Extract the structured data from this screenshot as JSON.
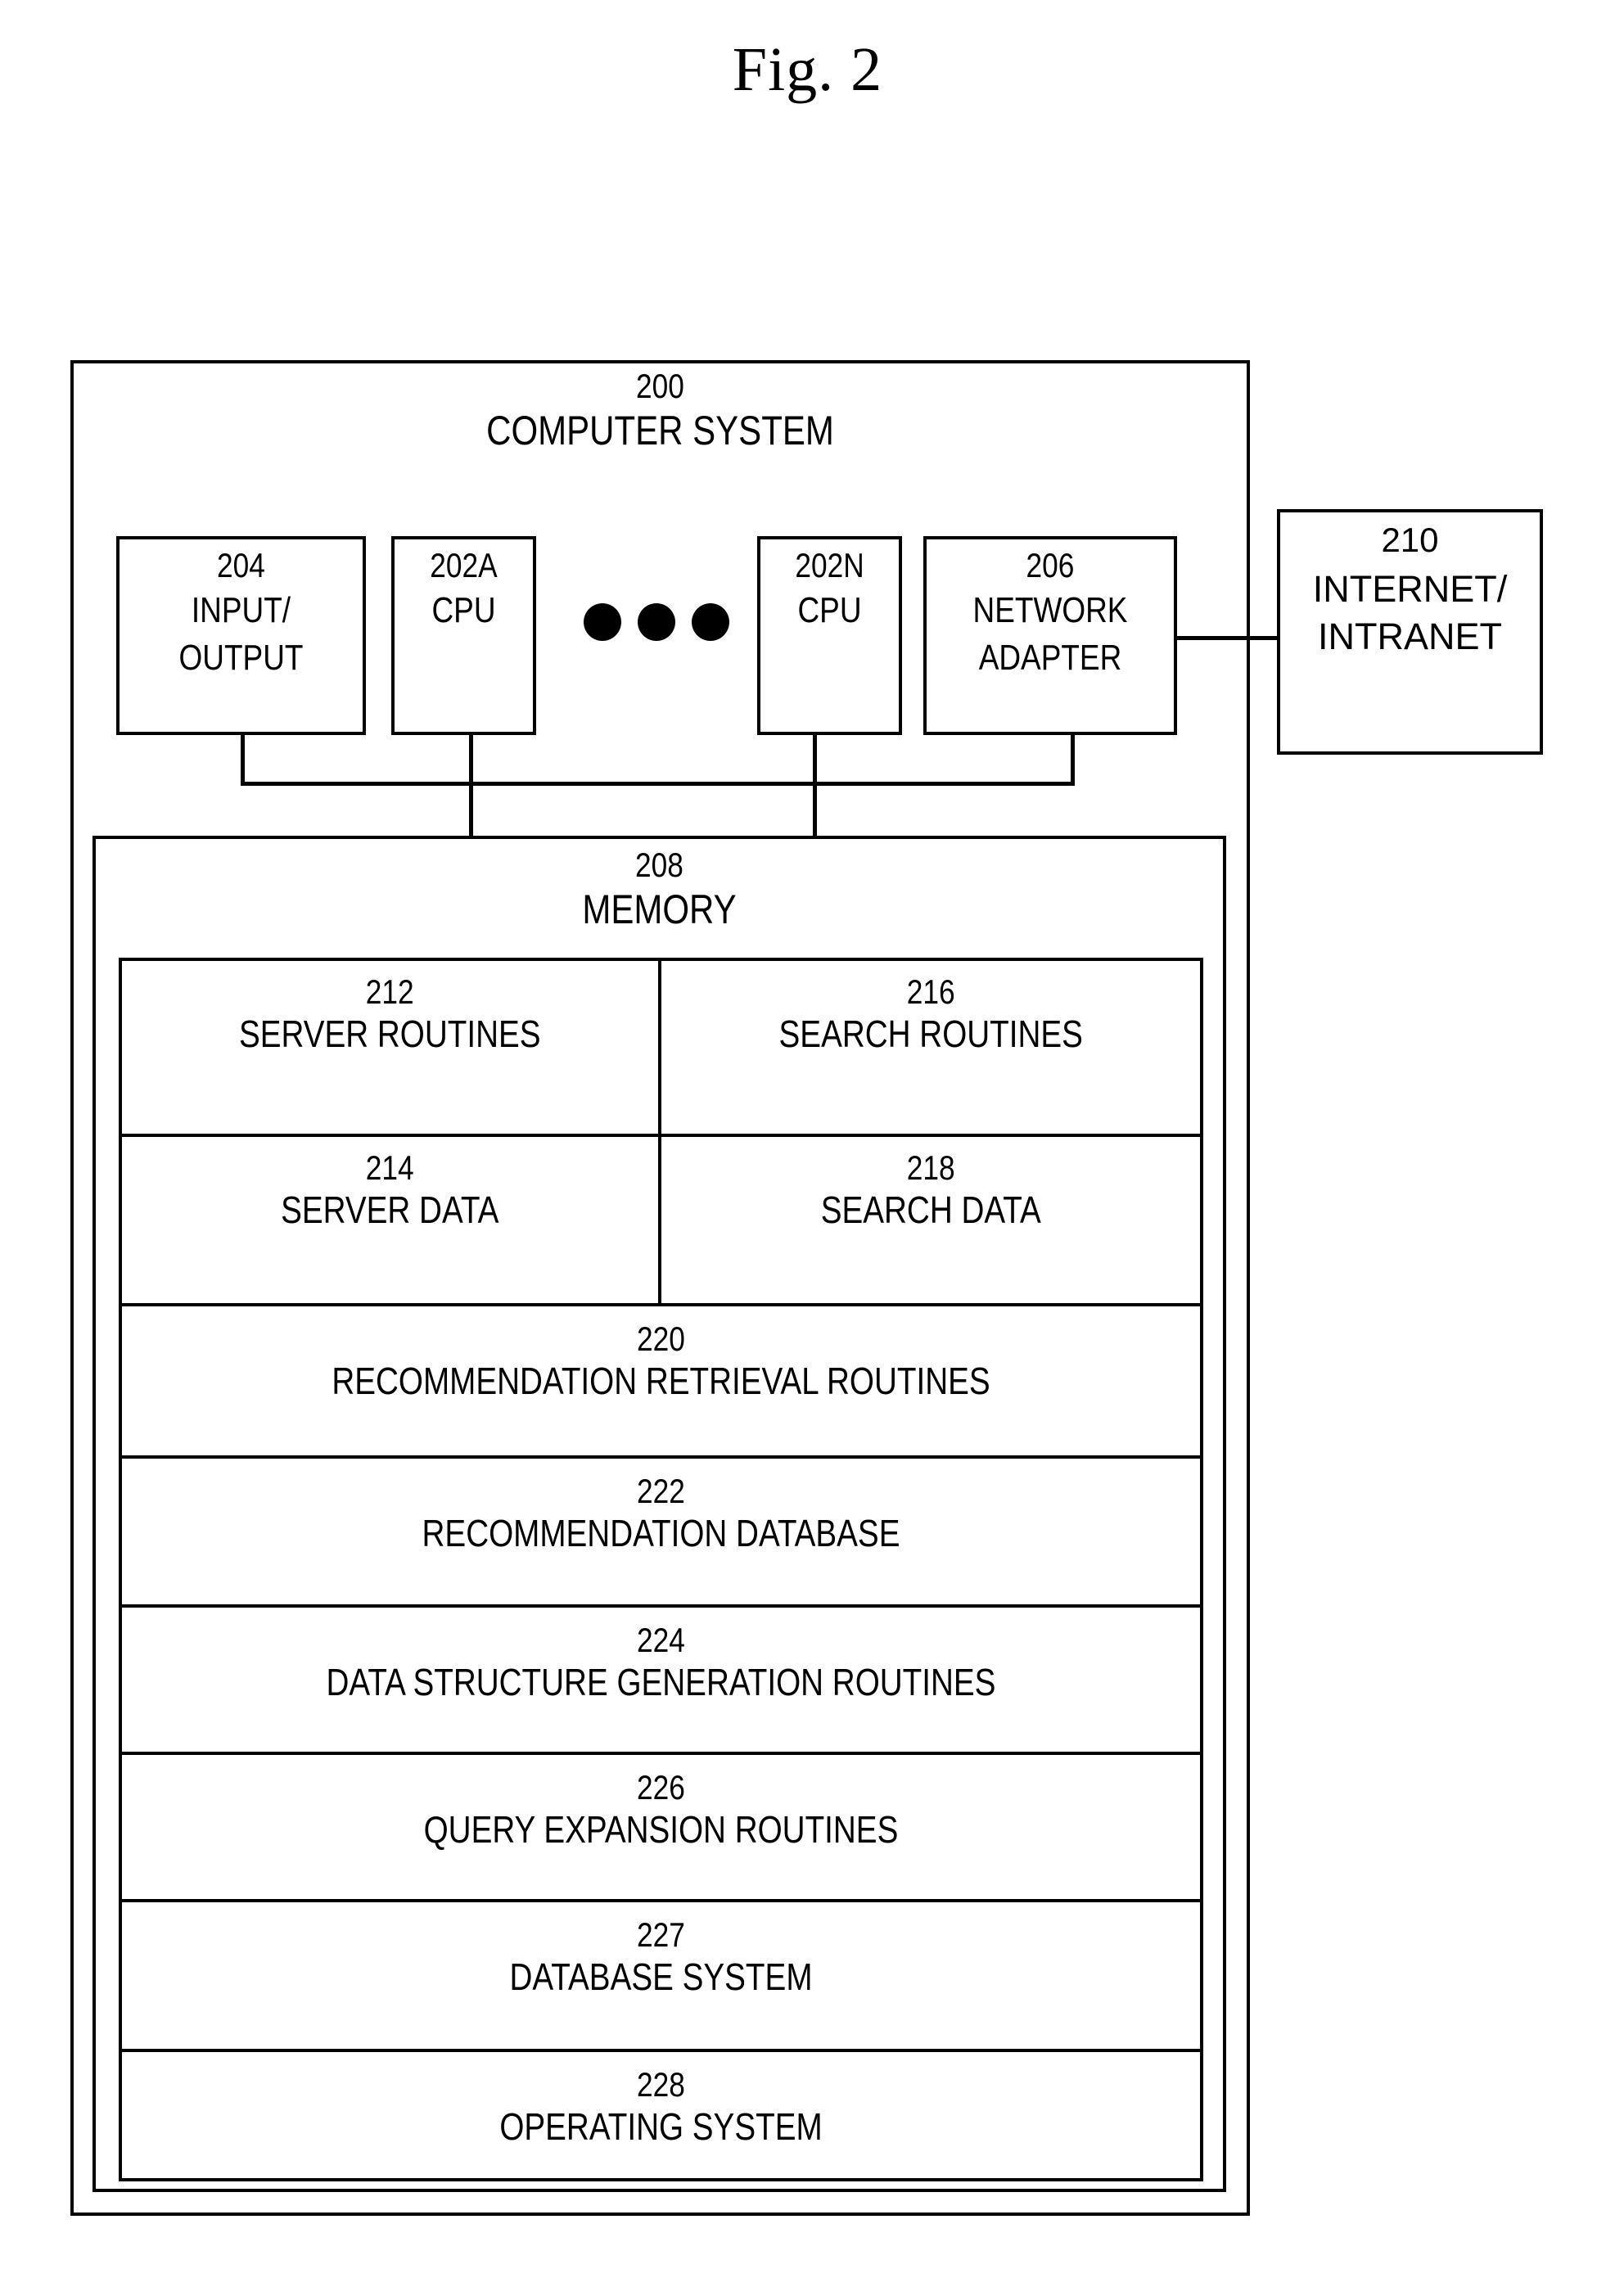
{
  "figure": {
    "title": "Fig. 2"
  },
  "system": {
    "ref": "200",
    "name": "COMPUTER SYSTEM"
  },
  "components": [
    {
      "ref": "204",
      "name_line1": "INPUT/",
      "name_line2": "OUTPUT"
    },
    {
      "ref": "202A",
      "name_line1": "CPU",
      "name_line2": ""
    },
    {
      "ref": "202N",
      "name_line1": "CPU",
      "name_line2": ""
    },
    {
      "ref": "206",
      "name_line1": "NETWORK",
      "name_line2": "ADAPTER"
    }
  ],
  "ellipsis": {
    "name": "continuation-dots",
    "count": 3
  },
  "network": {
    "ref": "210",
    "name_line1": "INTERNET/",
    "name_line2": "INTRANET"
  },
  "memory": {
    "ref": "208",
    "name": "MEMORY",
    "rows": [
      {
        "split": true,
        "left": {
          "ref": "212",
          "name": "SERVER ROUTINES"
        },
        "right": {
          "ref": "216",
          "name": "SEARCH ROUTINES"
        }
      },
      {
        "split": true,
        "left": {
          "ref": "214",
          "name": "SERVER DATA"
        },
        "right": {
          "ref": "218",
          "name": "SEARCH DATA"
        }
      },
      {
        "split": false,
        "ref": "220",
        "name": "RECOMMENDATION RETRIEVAL ROUTINES"
      },
      {
        "split": false,
        "ref": "222",
        "name": "RECOMMENDATION DATABASE"
      },
      {
        "split": false,
        "ref": "224",
        "name": "DATA STRUCTURE GENERATION ROUTINES"
      },
      {
        "split": false,
        "ref": "226",
        "name": "QUERY EXPANSION ROUTINES"
      },
      {
        "split": false,
        "ref": "227",
        "name": "DATABASE SYSTEM"
      },
      {
        "split": false,
        "ref": "228",
        "name": "OPERATING SYSTEM"
      }
    ]
  },
  "colors": {
    "ink": "#000000",
    "paper": "#ffffff"
  }
}
